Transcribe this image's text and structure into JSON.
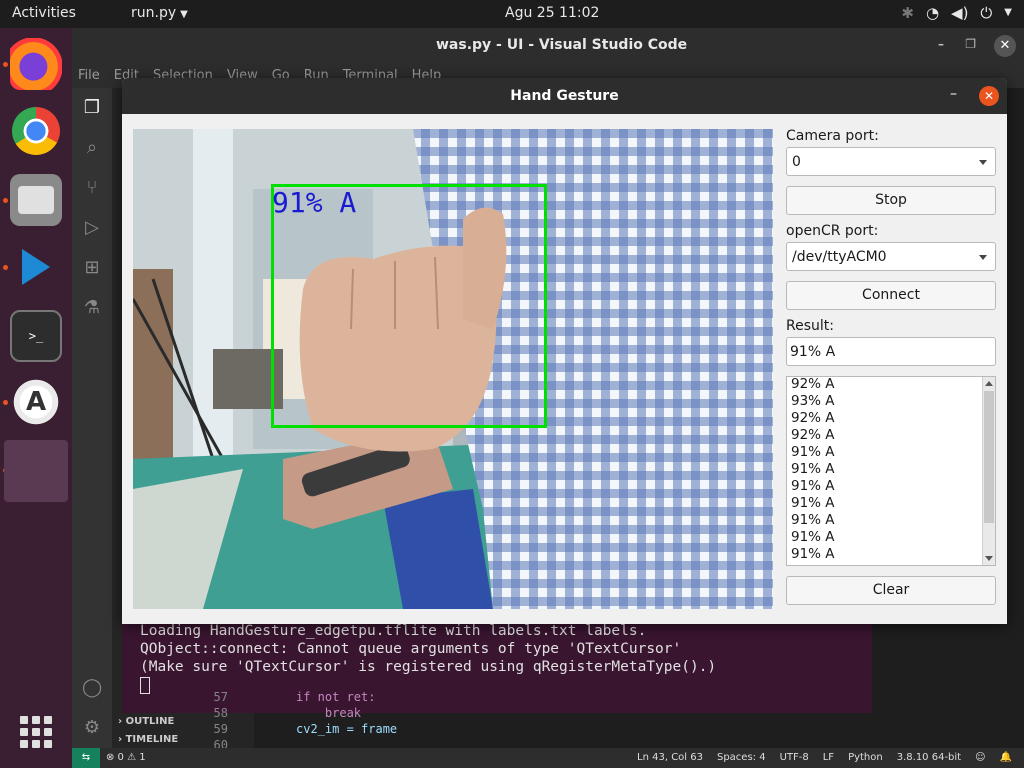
{
  "topbar": {
    "activities": "Activities",
    "app_menu": "run.py",
    "clock": "Agu 25  11:02"
  },
  "dock": {
    "items": [
      "firefox-icon",
      "chrome-icon",
      "files-icon",
      "vscode-icon",
      "terminal-icon",
      "software-store-icon"
    ]
  },
  "vscode": {
    "window_title": "was.py - UI - Visual Studio Code",
    "menu": [
      "File",
      "Edit",
      "Selection",
      "View",
      "Go",
      "Run",
      "Terminal",
      "Help"
    ],
    "sidebar_sections": [
      "OUTLINE",
      "TIMELINE"
    ],
    "terminal_lines": [
      "Loading HandGesture_edgetpu.tflite with labels.txt labels.",
      "QObject::connect: Cannot queue arguments of type 'QTextCursor'",
      "(Make sure 'QTextCursor' is registered using qRegisterMetaType().)"
    ],
    "code_lines": [
      {
        "num": "57",
        "text": "if not ret:"
      },
      {
        "num": "58",
        "text": "    break"
      },
      {
        "num": "59",
        "text": "cv2_im = frame"
      },
      {
        "num": "60",
        "text": ""
      }
    ],
    "status_left": "⊗ 0 ⚠ 1",
    "status_right": [
      "Ln 43, Col 63",
      "Spaces: 4",
      "UTF-8",
      "LF",
      "Python",
      "3.8.10 64-bit"
    ],
    "accent_color": "#16825d"
  },
  "dialog": {
    "title": "Hand Gesture",
    "minimize": "–",
    "close": "✕",
    "camera_overlay_label": "91% A",
    "camera_port_label": "Camera port:",
    "camera_port_value": "0",
    "stop_button": "Stop",
    "opencr_port_label": "openCR port:",
    "opencr_port_value": "/dev/ttyACM0",
    "connect_button": "Connect",
    "result_label": "Result:",
    "result_value": "91% A",
    "history": [
      "92% A",
      "93% A",
      "92% A",
      "92% A",
      "91% A",
      "91% A",
      "91% A",
      "91% A",
      "91% A",
      "91% A",
      "91% A"
    ],
    "clear_button": "Clear",
    "bbox_color": "#00e000",
    "label_color": "#1a1ad0"
  }
}
